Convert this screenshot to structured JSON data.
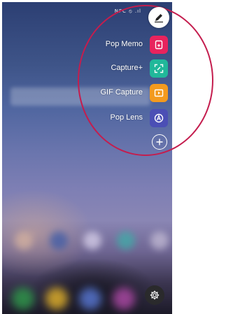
{
  "status_bar": {
    "icons_text": "NFC  ⦸  .ıl"
  },
  "pen_button": {
    "icon": "pen-icon"
  },
  "menu": {
    "items": [
      {
        "label": "Pop Memo",
        "icon": "pop-memo-icon",
        "color": "#e8235d"
      },
      {
        "label": "Capture+",
        "icon": "capture-plus-icon",
        "color": "#21b89a"
      },
      {
        "label": "GIF Capture",
        "icon": "gif-capture-icon",
        "color": "#f39a1e"
      },
      {
        "label": "Pop Lens",
        "icon": "pop-lens-icon",
        "color": "#4b4fb5"
      }
    ],
    "add_icon": "add-icon"
  },
  "settings_button": {
    "icon": "gear-icon"
  },
  "colors": {
    "magnifier_ring": "#c41d4e"
  }
}
